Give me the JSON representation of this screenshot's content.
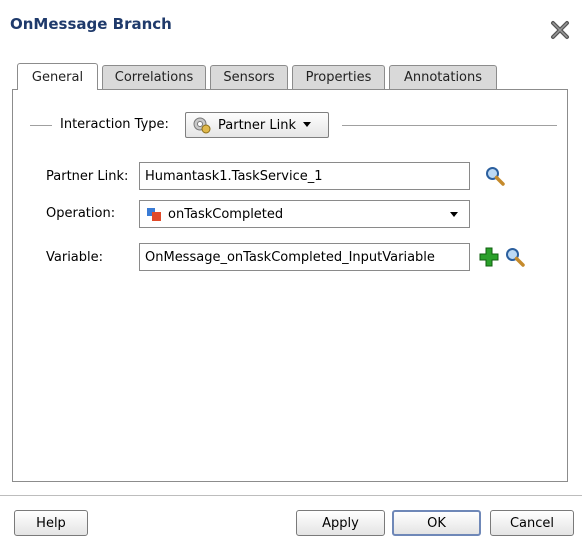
{
  "dialog": {
    "title": "OnMessage Branch",
    "close_icon": "close-icon"
  },
  "tabs": [
    {
      "label": "General",
      "active": true
    },
    {
      "label": "Correlations",
      "active": false
    },
    {
      "label": "Sensors",
      "active": false
    },
    {
      "label": "Properties",
      "active": false
    },
    {
      "label": "Annotations",
      "active": false
    }
  ],
  "interaction": {
    "label": "Interaction Type:",
    "value": "Partner Link",
    "icon": "partner-link-icon"
  },
  "fields": {
    "partner_link": {
      "label": "Partner Link:",
      "value": "Humantask1.TaskService_1",
      "icon": "search-icon"
    },
    "operation": {
      "label": "Operation:",
      "value": "onTaskCompleted",
      "icon": "operation-icon"
    },
    "variable": {
      "label": "Variable:",
      "value": "OnMessage_onTaskCompleted_InputVariable",
      "add_icon": "add-icon",
      "search_icon": "search-icon"
    }
  },
  "buttons": {
    "help": "Help",
    "apply": "Apply",
    "ok": "OK",
    "cancel": "Cancel"
  },
  "colors": {
    "title": "#1f3a6b",
    "tab_inactive": "#d9d9d9",
    "add_icon_green": "#2aa02a"
  }
}
